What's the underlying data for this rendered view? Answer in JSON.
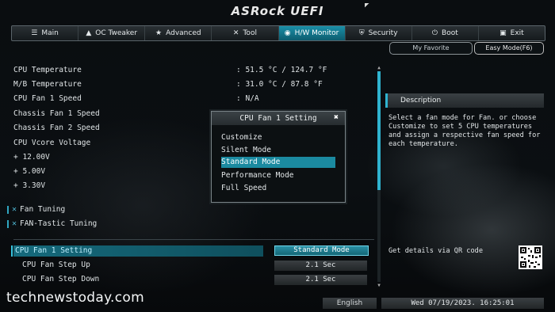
{
  "brand": "ASRock UEFI",
  "menu": [
    {
      "label": "Main",
      "icon": "list-icon",
      "glyph": "☰",
      "active": false
    },
    {
      "label": "OC Tweaker",
      "icon": "rocket-icon",
      "glyph": "▲",
      "active": false
    },
    {
      "label": "Advanced",
      "icon": "star-icon",
      "glyph": "★",
      "active": false
    },
    {
      "label": "Tool",
      "icon": "tools-icon",
      "glyph": "✕",
      "active": false
    },
    {
      "label": "H/W Monitor",
      "icon": "monitor-icon",
      "glyph": "◉",
      "active": true
    },
    {
      "label": "Security",
      "icon": "shield-icon",
      "glyph": "⛨",
      "active": false
    },
    {
      "label": "Boot",
      "icon": "power-icon",
      "glyph": "⏻",
      "active": false
    },
    {
      "label": "Exit",
      "icon": "exit-icon",
      "glyph": "▣",
      "active": false
    }
  ],
  "my_favorite": "My Favorite",
  "easy_mode": "Easy Mode(F6)",
  "monitor": [
    {
      "label": "CPU Temperature",
      "value": ": 51.5 °C / 124.7 °F"
    },
    {
      "label": "M/B Temperature",
      "value": ": 31.0 °C /  87.8 °F"
    },
    {
      "label": "CPU Fan 1 Speed",
      "value": ": N/A"
    },
    {
      "label": "Chassis Fan 1 Speed",
      "value": ""
    },
    {
      "label": "Chassis Fan 2 Speed",
      "value": ""
    },
    {
      "label": "CPU Vcore Voltage",
      "value": ""
    },
    {
      "label": "+ 12.00V",
      "value": ""
    },
    {
      "label": "+ 5.00V",
      "value": ""
    },
    {
      "label": "+ 3.30V",
      "value": ""
    }
  ],
  "tools": [
    "Fan Tuning",
    "FAN-Tastic Tuning"
  ],
  "settings": {
    "selected_label": "CPU Fan 1 Setting",
    "selected_value": "Standard Mode",
    "step_up_label": "CPU Fan Step Up",
    "step_up_value": "2.1 Sec",
    "step_down_label": "CPU Fan Step Down",
    "step_down_value": "2.1 Sec"
  },
  "popup": {
    "title": "CPU Fan 1 Setting",
    "options": [
      "Customize",
      "Silent Mode",
      "Standard Mode",
      "Performance Mode",
      "Full Speed"
    ],
    "selected_index": 2
  },
  "description": {
    "title": "Description",
    "text": "Select a fan mode for Fan. or choose Customize to set 5 CPU temperatures and assign a respective fan speed for each temperature.",
    "qr_label": "Get details via QR code"
  },
  "footer": {
    "language": "English",
    "datetime": "Wed 07/19/2023. 16:25:01"
  },
  "watermark": "technewstoday.com"
}
